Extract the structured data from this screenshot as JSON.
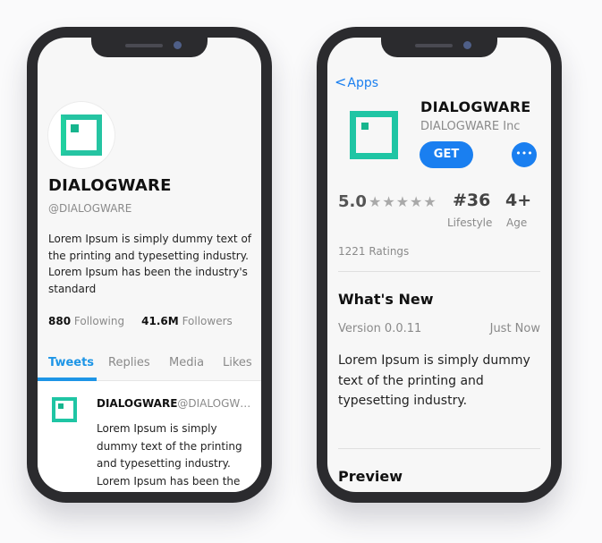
{
  "left_screen": {
    "profile": {
      "name": "DIALOGWARE",
      "handle": "@DIALOGWARE",
      "bio": "Lorem Ipsum is simply dummy text of the printing and typesetting industry. Lorem Ipsum has been the industry's standard",
      "following_count": "880",
      "following_label": "Following",
      "followers_count": "41.6M",
      "followers_label": "Followers"
    },
    "tabs": [
      {
        "label": "Tweets",
        "active": true
      },
      {
        "label": "Replies",
        "active": false
      },
      {
        "label": "Media",
        "active": false
      },
      {
        "label": "Likes",
        "active": false
      }
    ],
    "tweet": {
      "author": "DIALOGWARE",
      "handle": "@DIALOGW…",
      "text": "Lorem Ipsum is simply dummy text of the printing and typesetting industry. Lorem Ipsum has been the"
    }
  },
  "right_screen": {
    "back_label": "Apps",
    "app": {
      "name": "DIALOGWARE",
      "developer": "DIALOGWARE Inc",
      "get_label": "GET",
      "more_icon": "more-icon"
    },
    "stats": {
      "rating": "5.0",
      "stars": "★★★★★",
      "rank": "#36",
      "rank_label": "Lifestyle",
      "age": "4+",
      "age_label": "Age",
      "ratings_count": "1221 Ratings"
    },
    "whats_new": {
      "title": "What's New",
      "version": "Version 0.0.11",
      "when": "Just Now",
      "description": "Lorem Ipsum is simply dummy text of the printing and typesetting industry."
    },
    "preview_title": "Preview"
  },
  "colors": {
    "accent_blue": "#1a7ff0",
    "twitter_blue": "#1d95e6",
    "logo_green": "#1fc5a4",
    "phone_frame": "#2b2b2e"
  }
}
